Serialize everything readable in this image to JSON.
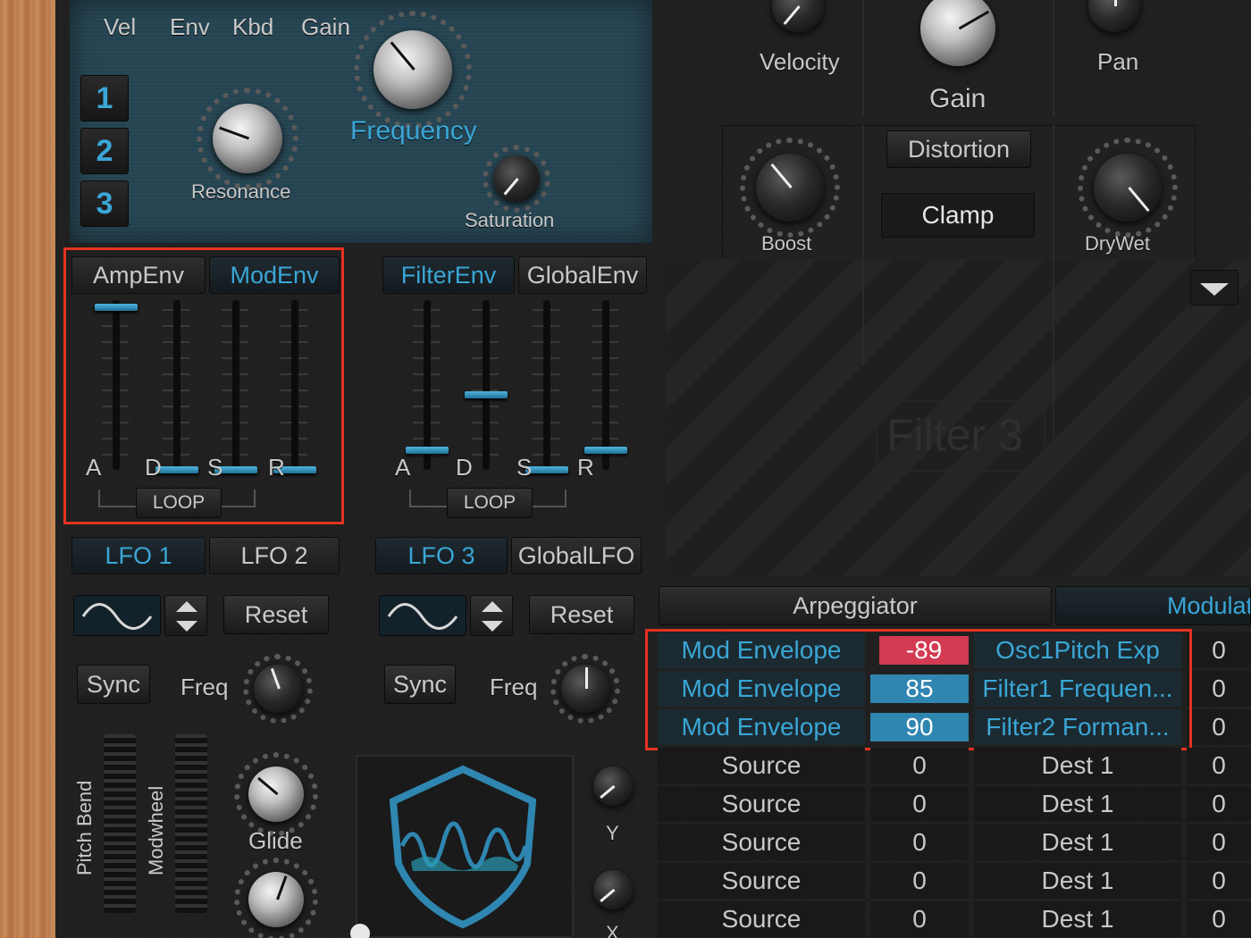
{
  "filter": {
    "mod_labels": [
      "Vel",
      "Env",
      "Kbd",
      "Gain"
    ],
    "filter_buttons": [
      "1",
      "2",
      "3"
    ],
    "frequency_label": "Frequency",
    "resonance_label": "Resonance",
    "saturation_label": "Saturation"
  },
  "amp": {
    "velocity_label": "Velocity",
    "gain_label": "Gain",
    "pan_label": "Pan"
  },
  "distortion": {
    "title": "Distortion",
    "mode_value": "Clamp",
    "boost_label": "Boost",
    "drywet_label": "DryWet"
  },
  "filter3_label": "Filter 3",
  "envelopes": {
    "left_tabs": [
      "AmpEnv",
      "ModEnv"
    ],
    "right_tabs": [
      "FilterEnv",
      "GlobalEnv"
    ],
    "adsr_labels": [
      "A",
      "D",
      "S",
      "R"
    ],
    "loop_label": "LOOP"
  },
  "lfos": {
    "left_tabs": [
      "LFO 1",
      "LFO 2"
    ],
    "right_tabs": [
      "LFO 3",
      "GlobalLFO"
    ],
    "reset_label": "Reset",
    "sync_label": "Sync",
    "freq_label": "Freq"
  },
  "performance": {
    "pitch_bend_label": "Pitch Bend",
    "modwheel_label": "Modwheel",
    "glide_label": "Glide",
    "y_label": "Y",
    "x_label": "X"
  },
  "bottom_tabs": {
    "arpeggiator": "Arpeggiator",
    "modulation": "Modulat"
  },
  "mod_matrix": {
    "highlighted_rows": [
      {
        "source": "Mod Envelope",
        "amount": "-89",
        "dest": "Osc1Pitch Exp",
        "extra": "0"
      },
      {
        "source": "Mod Envelope",
        "amount": "85",
        "dest": "Filter1 Frequen...",
        "extra": "0"
      },
      {
        "source": "Mod Envelope",
        "amount": "90",
        "dest": "Filter2 Forman...",
        "extra": "0"
      }
    ],
    "plain_rows": [
      {
        "source": "Source",
        "amount": "0",
        "dest": "Dest 1",
        "extra": "0"
      },
      {
        "source": "Source",
        "amount": "0",
        "dest": "Dest 1",
        "extra": "0"
      },
      {
        "source": "Source",
        "amount": "0",
        "dest": "Dest 1",
        "extra": "0"
      },
      {
        "source": "Source",
        "amount": "0",
        "dest": "Dest 1",
        "extra": "0"
      },
      {
        "source": "Source",
        "amount": "0",
        "dest": "Dest 1",
        "extra": "0"
      }
    ]
  },
  "colors": {
    "accent": "#3aa6d6",
    "negative": "#d23b52",
    "positive": "#2f86b0",
    "highlight_box": "#e53222"
  }
}
